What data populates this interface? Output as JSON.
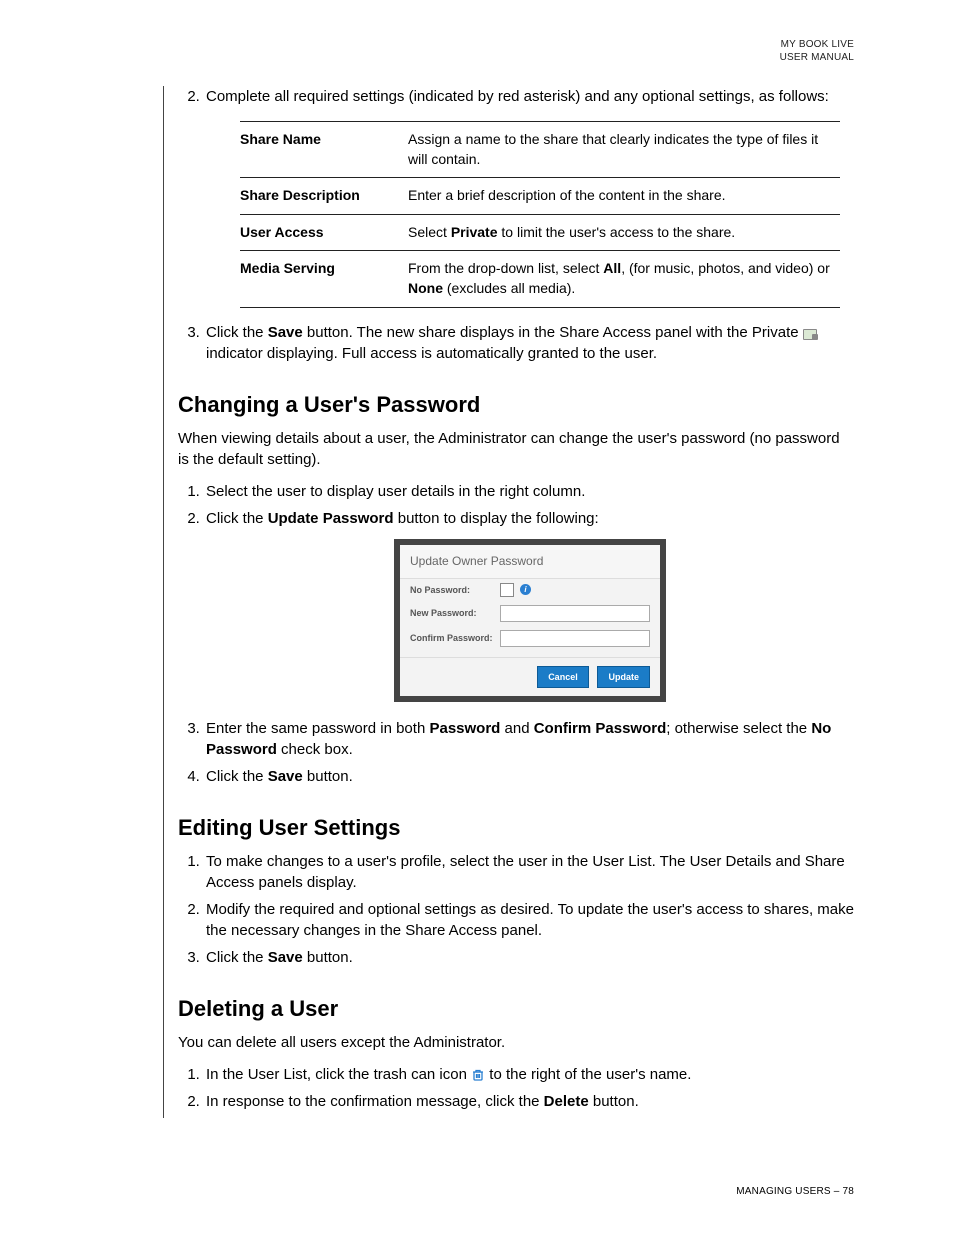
{
  "header": {
    "line1": "MY BOOK LIVE",
    "line2": "USER MANUAL"
  },
  "step2": {
    "text_a": "Complete all required settings (indicated by red asterisk) and any optional settings, as follows:"
  },
  "table": {
    "rows": [
      {
        "label": "Share Name",
        "desc_a": "Assign a name to the share that clearly indicates the type of files it will contain."
      },
      {
        "label": "Share Description",
        "desc_a": "Enter a brief description of the content in the share."
      },
      {
        "label": "User Access",
        "desc_a": "Select ",
        "bold1": "Private",
        "desc_b": " to limit the user's access to the share."
      },
      {
        "label": "Media Serving",
        "desc_a": "From the drop-down list, select ",
        "bold1": "All",
        "desc_b": ", (for music, photos, and video) or ",
        "bold2": "None",
        "desc_c": " (excludes all media)."
      }
    ]
  },
  "step3": {
    "a": "Click the ",
    "save": "Save",
    "b": " button. The new share displays in the Share Access panel with the Private ",
    "c": " indicator displaying. Full access is automatically granted to the user."
  },
  "sec_change": {
    "title": "Changing a User's Password",
    "intro": "When viewing details about a user, the Administrator can change the user's password (no password is the default setting).",
    "s1": "Select the user to display user details in the right column.",
    "s2a": "Click the ",
    "s2_bold": "Update Password",
    "s2b": " button to display the following:",
    "s3a": "Enter the same password in both ",
    "s3_b1": "Password",
    "s3b": " and ",
    "s3_b2": "Confirm Password",
    "s3c": "; otherwise select the ",
    "s3_b3": "No Password",
    "s3d": " check box.",
    "s4a": "Click the ",
    "s4_bold": "Save",
    "s4b": " button."
  },
  "dialog": {
    "title": "Update Owner Password",
    "no_pw": "No Password:",
    "new_pw": "New Password:",
    "conf_pw": "Confirm Password:",
    "cancel": "Cancel",
    "update": "Update"
  },
  "sec_edit": {
    "title": "Editing User Settings",
    "s1": "To make changes to a user's profile, select the user in the User List. The User Details and Share Access panels display.",
    "s2": "Modify the required and optional settings as desired. To update the user's access to shares, make the necessary changes in the Share Access panel.",
    "s3a": "Click the ",
    "s3_bold": "Save",
    "s3b": " button."
  },
  "sec_delete": {
    "title": "Deleting a User",
    "intro": "You can delete all users except the Administrator.",
    "s1a": "In the User List, click the trash can icon ",
    "s1b": " to the right of the user's name.",
    "s2a": "In response to the confirmation message, click the ",
    "s2_bold": "Delete",
    "s2b": " button."
  },
  "footer": {
    "text": "MANAGING USERS – 78"
  }
}
